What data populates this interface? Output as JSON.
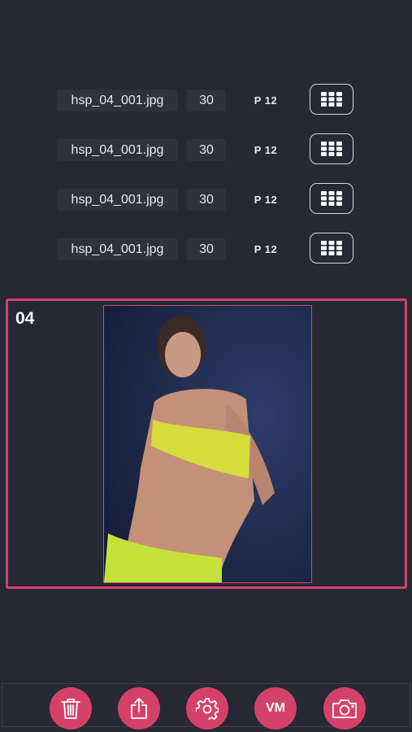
{
  "file_rows": [
    {
      "filename": "hsp_04_001.jpg",
      "count": "30",
      "page": "P 12"
    },
    {
      "filename": "hsp_04_001.jpg",
      "count": "30",
      "page": "P 12"
    },
    {
      "filename": "hsp_04_001.jpg",
      "count": "30",
      "page": "P 12"
    },
    {
      "filename": "hsp_04_001.jpg",
      "count": "30",
      "page": "P 12"
    }
  ],
  "preview": {
    "number": "04"
  },
  "toolbar": {
    "vm_label": "VM"
  },
  "colors": {
    "background": "#262833",
    "accent": "#d4426a",
    "field_bg": "#2f313d",
    "text": "#e8e8ec"
  },
  "icons": [
    "grid-icon",
    "trash-icon",
    "share-icon",
    "gear-icon",
    "camera-icon"
  ]
}
